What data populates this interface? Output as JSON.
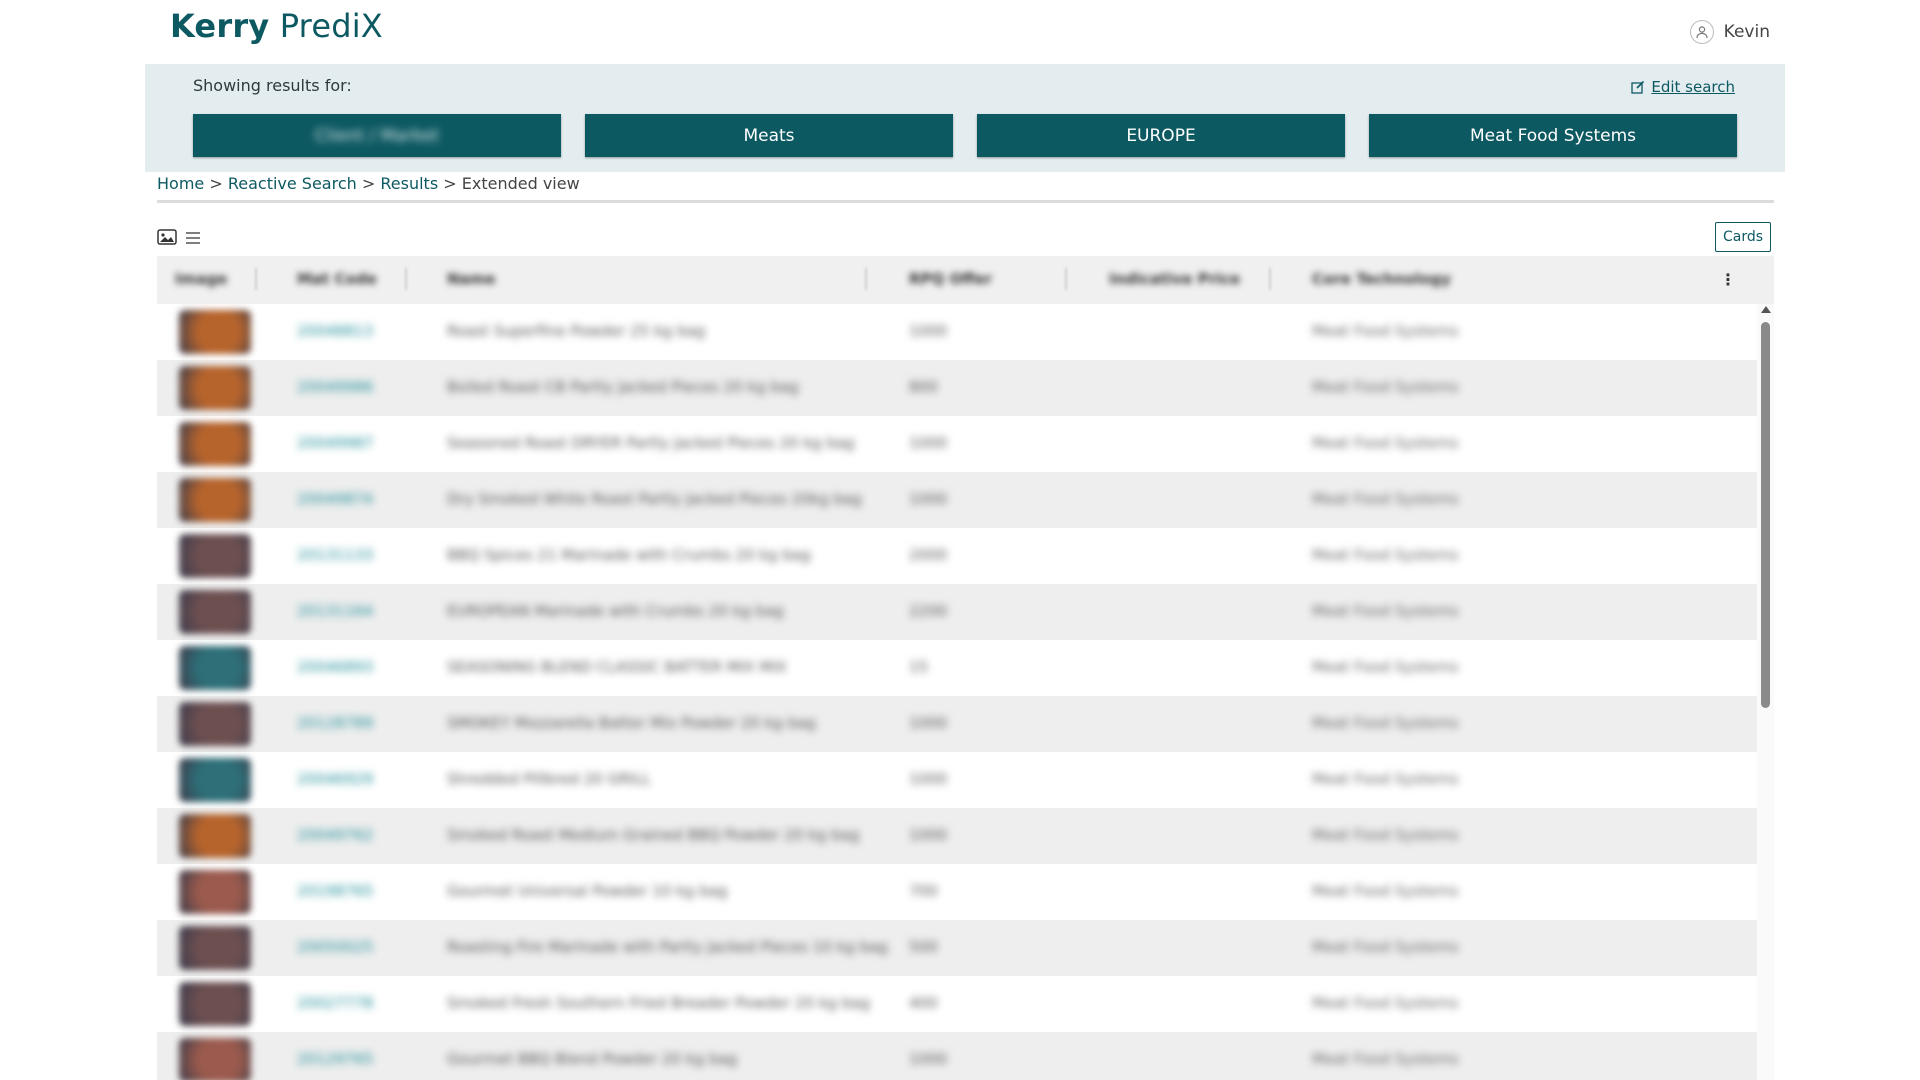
{
  "app": {
    "brand_bold": "Kerry",
    "brand_light": "PrediX"
  },
  "user": {
    "name": "Kevin"
  },
  "summary": {
    "label": "Showing results for:",
    "edit_label": "Edit search",
    "chips": [
      "Client / Market",
      "Meats",
      "EUROPE",
      "Meat Food Systems"
    ]
  },
  "breadcrumb": [
    {
      "label": "Home",
      "link": true
    },
    {
      "label": "Reactive Search",
      "link": true
    },
    {
      "label": "Results",
      "link": true
    },
    {
      "label": "Extended view",
      "link": false
    }
  ],
  "toolbar": {
    "cards_label": "Cards"
  },
  "table": {
    "columns": [
      "Image",
      "Mat Code",
      "Name",
      "RPQ Offer",
      "Indicative Price",
      "Core Technology"
    ],
    "rows": [
      {
        "code": "20048813",
        "name": "Roast Superfine Powder 25 kg bag",
        "value": "1000",
        "tech": "Meat Food Systems",
        "color": "#b7642c"
      },
      {
        "code": "20049986",
        "name": "Boiled Roast CB Partly Jacked Pieces 20 kg bag",
        "value": "800",
        "tech": "Meat Food Systems",
        "color": "#b7642c"
      },
      {
        "code": "20049987",
        "name": "Seasoned Roast DRYER Partly Jacked Pieces 20 kg bag",
        "value": "1000",
        "tech": "Meat Food Systems",
        "color": "#b7642c"
      },
      {
        "code": "20049874",
        "name": "Dry Smoked White Roast Partly Jacked Pieces 20kg bag",
        "value": "1000",
        "tech": "Meat Food Systems",
        "color": "#b7642c"
      },
      {
        "code": "20131133",
        "name": "BBQ Spices 21 Marinade with Crumbs 20 kg bag",
        "value": "2000",
        "tech": "Meat Food Systems",
        "color": "#6d4f50"
      },
      {
        "code": "20131164",
        "name": "EUROPEAN Marinade with Crumbs 20 kg bag",
        "value": "2200",
        "tech": "Meat Food Systems",
        "color": "#6d4f50"
      },
      {
        "code": "20046893",
        "name": "SEASONING BLEND CLASSIC BATTER MIX MIX",
        "value": "15",
        "tech": "Meat Food Systems",
        "color": "#2e6f78"
      },
      {
        "code": "20128789",
        "name": "SMOKEY Mozzarella Batter Mix Powder 20 kg bag",
        "value": "1000",
        "tech": "Meat Food Systems",
        "color": "#6d4f50"
      },
      {
        "code": "20046929",
        "name": "Shredded Pillbred 20 GRILL",
        "value": "1000",
        "tech": "Meat Food Systems",
        "color": "#2e6f78"
      },
      {
        "code": "20049762",
        "name": "Smoked Roast Medium Grained BBQ Powder 20 kg bag",
        "value": "1000",
        "tech": "Meat Food Systems",
        "color": "#b7642c"
      },
      {
        "code": "20198765",
        "name": "Gourmet Universal Powder 10 kg bag",
        "value": "700",
        "tech": "Meat Food Systems",
        "color": "#9b5a4d"
      },
      {
        "code": "20050025",
        "name": "Roasting Fire Marinade with Partly Jacked Pieces 10 kg bag",
        "value": "500",
        "tech": "Meat Food Systems",
        "color": "#6d4f50"
      },
      {
        "code": "20027778",
        "name": "Smoked Fresh Southern Fried Breader Powder 20 kg bag",
        "value": "400",
        "tech": "Meat Food Systems",
        "color": "#6d4f50"
      },
      {
        "code": "20129765",
        "name": "Gourmet BBQ Blend Powder 20 kg bag",
        "value": "1000",
        "tech": "Meat Food Systems",
        "color": "#9b5a4d"
      }
    ]
  }
}
